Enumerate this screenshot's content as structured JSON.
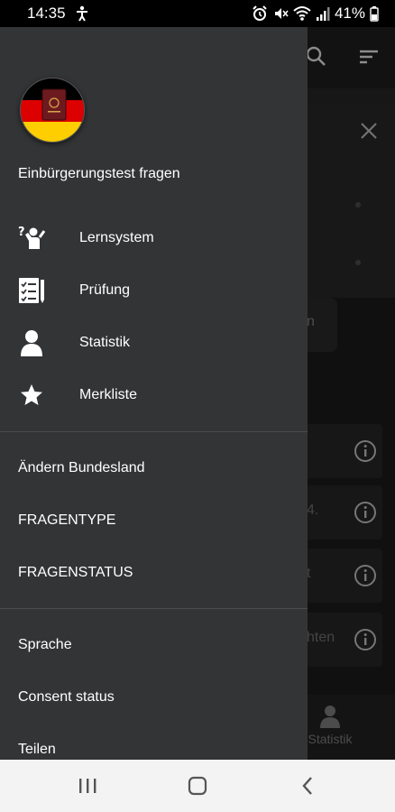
{
  "status_bar": {
    "time": "14:35",
    "battery": "41%"
  },
  "drawer": {
    "app_title": "Einbürgerungstest fragen",
    "nav_items": [
      {
        "label": "Lernsystem",
        "icon": "person-question-icon"
      },
      {
        "label": "Prüfung",
        "icon": "checklist-icon"
      },
      {
        "label": "Statistik",
        "icon": "person-icon"
      },
      {
        "label": "Merkliste",
        "icon": "star-icon"
      }
    ],
    "section_items": [
      {
        "label": "Ändern Bundesland"
      },
      {
        "label": "FRAGENTYPE"
      },
      {
        "label": "FRAGENSTATUS"
      }
    ],
    "footer_items": [
      {
        "label": "Sprache"
      },
      {
        "label": "Consent status"
      },
      {
        "label": "Teilen"
      }
    ]
  },
  "background": {
    "button_fragment": "n",
    "list_fragments": [
      "",
      "4.",
      "t",
      "hten"
    ],
    "bottom_nav_label": "Statistik"
  },
  "colors": {
    "drawer_bg": "#333436",
    "flag_black": "#000000",
    "flag_red": "#dd0000",
    "flag_gold": "#ffce00"
  }
}
